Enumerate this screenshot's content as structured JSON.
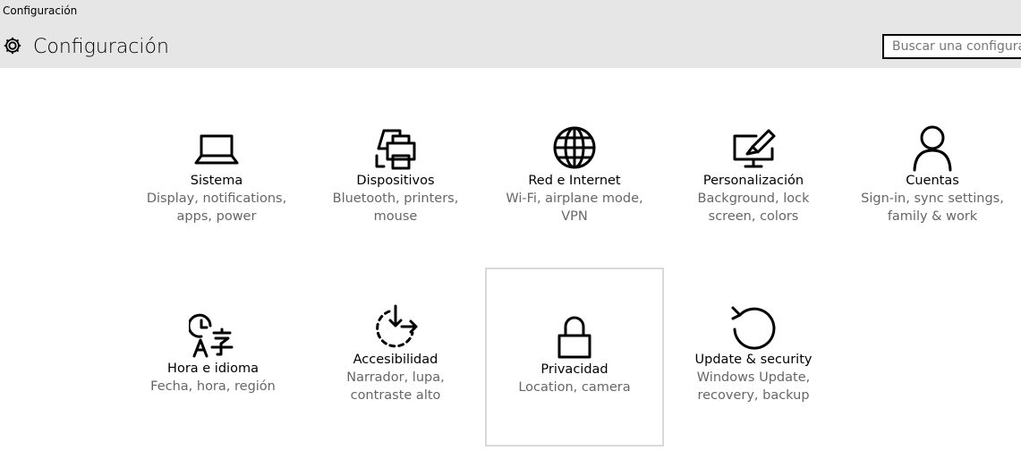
{
  "window": {
    "title": "Configuración"
  },
  "header": {
    "title": "Configuración",
    "search_placeholder": "Buscar una configuración"
  },
  "tiles": [
    {
      "name": "Sistema",
      "desc1": "Display, notifications,",
      "desc2": "apps, power",
      "icon": "laptop-icon"
    },
    {
      "name": "Dispositivos",
      "desc1": "Bluetooth, printers,",
      "desc2": "mouse",
      "icon": "devices-printer-icon"
    },
    {
      "name": "Red e Internet",
      "desc1": "Wi-Fi, airplane mode,",
      "desc2": "VPN",
      "icon": "globe-icon"
    },
    {
      "name": "Personalización",
      "desc1": "Background, lock",
      "desc2": "screen, colors",
      "icon": "paintbrush-monitor-icon"
    },
    {
      "name": "Cuentas",
      "desc1": "Sign-in, sync settings,",
      "desc2": "family & work",
      "icon": "person-icon"
    },
    {
      "name": "Hora e idioma",
      "desc1": "Fecha, hora, región",
      "desc2": "",
      "icon": "clock-language-icon"
    },
    {
      "name": "Accesibilidad",
      "desc1": "Narrador, lupa,",
      "desc2": "contraste alto",
      "icon": "ease-of-access-icon"
    },
    {
      "name": "Privacidad",
      "desc1": "Location, camera",
      "desc2": "",
      "icon": "lock-icon"
    },
    {
      "name": "Update & security",
      "desc1": "Windows Update,",
      "desc2": "recovery, backup",
      "icon": "refresh-icon"
    }
  ]
}
